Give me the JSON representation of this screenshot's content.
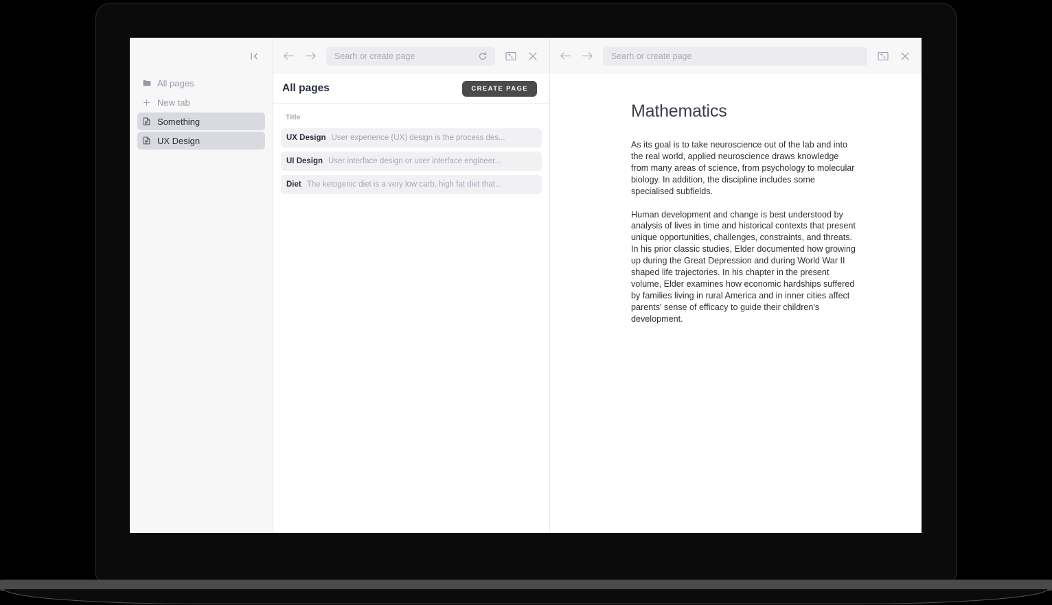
{
  "sidebar": {
    "collapse_icon": "collapse-sidebar-icon",
    "items": [
      {
        "label": "All pages",
        "icon": "folder-icon",
        "state": "plain"
      },
      {
        "label": "New tab",
        "icon": "plus-icon",
        "state": "plain"
      },
      {
        "label": "Something",
        "icon": "document-icon",
        "state": "active"
      },
      {
        "label": "UX Design",
        "icon": "document-icon",
        "state": "active"
      }
    ]
  },
  "list_panel": {
    "toolbar": {
      "back_icon": "arrow-left-icon",
      "forward_icon": "arrow-right-icon",
      "search_placeholder": "Searh or create page",
      "search_value": "",
      "refresh_icon": "refresh-icon",
      "expand_icon": "collapse-panel-icon",
      "close_icon": "close-icon"
    },
    "title": "All pages",
    "create_label": "CREATE PAGE",
    "column_header": "Title",
    "rows": [
      {
        "title": "UX Design",
        "snippet": "User experience (UX) design is the process des..."
      },
      {
        "title": "UI Design",
        "snippet": "User interface design or user interface engineer..."
      },
      {
        "title": "Diet",
        "snippet": "The ketogenic diet is a very low carb, high fat diet that..."
      }
    ]
  },
  "doc_panel": {
    "toolbar": {
      "back_icon": "arrow-left-icon",
      "forward_icon": "arrow-right-icon",
      "search_placeholder": "Searh or create page",
      "search_value": "",
      "expand_icon": "collapse-panel-icon",
      "close_icon": "close-icon"
    },
    "title": "Mathematics",
    "paragraphs": [
      "As its goal is to take neuroscience out of the lab and into the real world, applied neuroscience draws knowledge from many areas of science, from psychology to molecular biology. In addition, the discipline includes some specialised subfields.",
      "Human development and change is best understood by analysis of lives in time and historical contexts that present unique opportunities, challenges, constraints, and threats. In his prior classic studies, Elder documented how growing up during the Great Depression and during World War II shaped life trajectories. In his chapter in the present volume, Elder examines how economic hardships suffered by families living in rural America and in inner cities affect parents' sense of efficacy to guide their children's development."
    ]
  },
  "colors": {
    "accent_button": "#4b4b4d",
    "sidebar_bg": "#f7f7f8",
    "row_bg": "#f1f1f4",
    "active_item_bg": "#d9dae0",
    "muted_text": "#a6a7b6"
  }
}
